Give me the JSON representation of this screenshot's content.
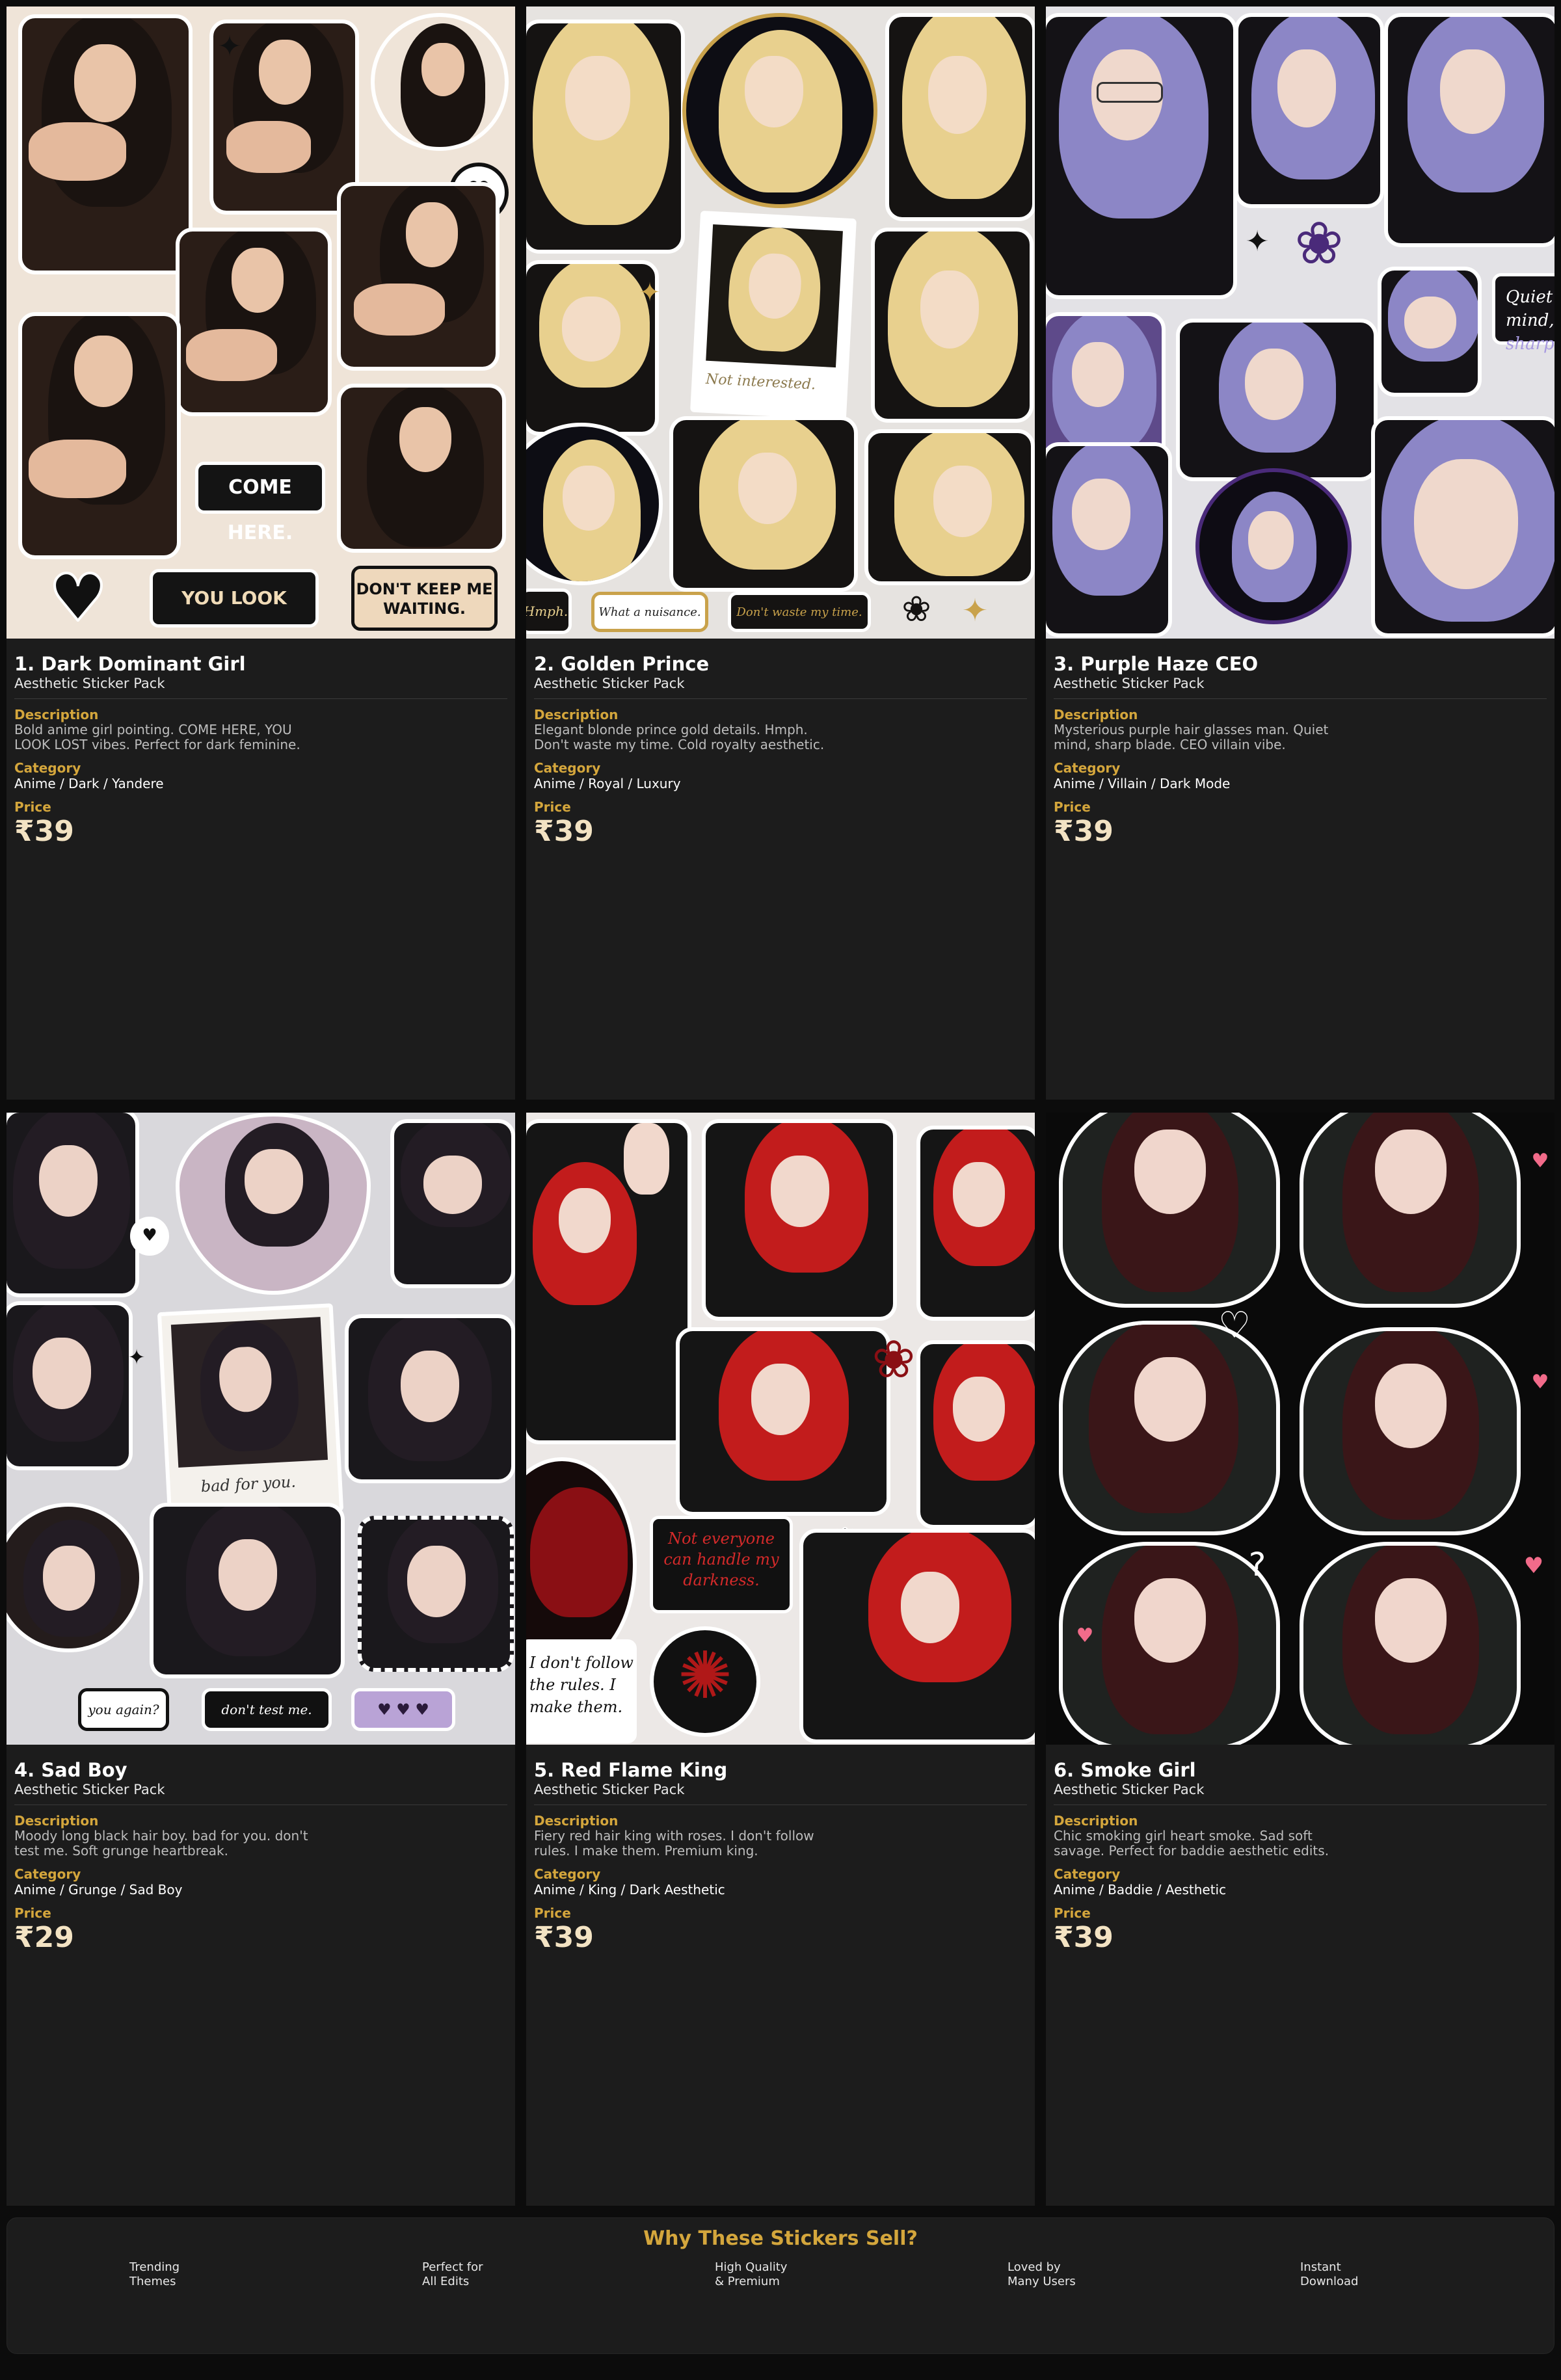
{
  "products": [
    {
      "title": "1. Dark Dominant Girl",
      "subtitle": "Aesthetic Sticker Pack",
      "description_label": "Description",
      "description": "Bold anime girl pointing. COME HERE, YOU LOOK LOST vibes. Perfect for dark feminine.",
      "category_label": "Category",
      "category": "Anime / Dark / Yandere",
      "price_label": "Price",
      "price": "₹39",
      "stickers": [
        "COME HERE.",
        "YOU LOOK LOST.",
        "DON'T KEEP ME WAITING."
      ],
      "colors": {
        "bg": "#efe4d8",
        "hair": "#1a1310",
        "skin": "#e9c4a8",
        "cloth": "#2a1d17"
      }
    },
    {
      "title": "2. Golden Prince",
      "subtitle": "Aesthetic Sticker Pack",
      "description_label": "Description",
      "description": "Elegant blonde prince gold details. Hmph. Don't waste my time. Cold royalty aesthetic.",
      "category_label": "Category",
      "category": "Anime / Royal / Luxury",
      "price_label": "Price",
      "price": "₹39",
      "stickers": [
        "Not interested.",
        "Hmph.",
        "What a nuisance.",
        "Don't waste my time."
      ],
      "colors": {
        "bg": "#e6e3e0",
        "hair": "#e8d08e",
        "skin": "#f3dcc6",
        "cloth": "#151312"
      }
    },
    {
      "title": "3. Purple Haze CEO",
      "subtitle": "Aesthetic Sticker Pack",
      "description_label": "Description",
      "description": "Mysterious purple hair glasses man. Quiet mind, sharp blade. CEO villain vibe.",
      "category_label": "Category",
      "category": "Anime / Villain / Dark Mode",
      "price_label": "Price",
      "price": "₹39",
      "stickers": [
        "Quiet mind,",
        "sharp"
      ],
      "colors": {
        "bg": "#e3e2e6",
        "hair": "#8c86c6",
        "skin": "#efd8cc",
        "cloth": "#141216"
      }
    },
    {
      "title": "4. Sad Boy",
      "subtitle": "Aesthetic Sticker Pack",
      "description_label": "Description",
      "description": "Moody long black hair boy. bad for you. don't test me. Soft grunge heartbreak.",
      "category_label": "Category",
      "category": "Anime / Grunge / Sad Boy",
      "price_label": "Price",
      "price": "₹29",
      "stickers": [
        "bad for you.",
        "you again?",
        "don't test me.",
        "♥ ♥ ♥"
      ],
      "colors": {
        "bg": "#d9d8dc",
        "hair": "#231c24",
        "skin": "#ecd2c6",
        "cloth": "#1a181c"
      }
    },
    {
      "title": "5. Red Flame King",
      "subtitle": "Aesthetic Sticker Pack",
      "description_label": "Description",
      "description": "Fiery red hair king with roses. I don't follow rules. I make them. Premium king.",
      "category_label": "Category",
      "category": "Anime / King / Dark Aesthetic",
      "price_label": "Price",
      "price": "₹39",
      "stickers": [
        "Not everyone can handle my darkness.",
        "I don't follow the rules. I make them."
      ],
      "colors": {
        "bg": "#ece8e6",
        "hair": "#c21c1c",
        "skin": "#f1d8cc",
        "cloth": "#151515"
      }
    },
    {
      "title": "6. Smoke Girl",
      "subtitle": "Aesthetic Sticker Pack",
      "description_label": "Description",
      "description": "Chic smoking girl heart smoke. Sad soft savage. Perfect for baddie aesthetic edits.",
      "category_label": "Category",
      "category": "Anime / Baddie / Aesthetic",
      "price_label": "Price",
      "price": "₹39",
      "stickers": [],
      "colors": {
        "bg": "#0a0a0a",
        "hair": "#3a1618",
        "skin": "#f0d6cc",
        "cloth": "#1f2220"
      }
    }
  ],
  "why": {
    "title": "Why These Stickers Sell?",
    "features": [
      "Trending\nThemes",
      "Perfect for\nAll Edits",
      "High Quality\n& Premium",
      "Loved by\nMany Users",
      "Instant\nDownload"
    ]
  }
}
